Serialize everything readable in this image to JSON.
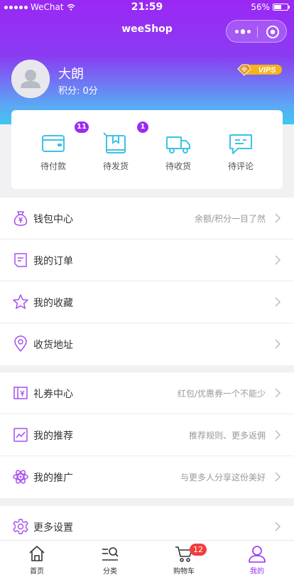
{
  "status_bar": {
    "carrier": "WeChat",
    "time": "21:59",
    "battery_text": "56%",
    "battery_level": 0.56
  },
  "nav": {
    "title": "weeShop"
  },
  "user": {
    "name": "大朗",
    "points": "积分: 0分",
    "vip_text": "VIPS"
  },
  "orders": [
    {
      "label": "待付款",
      "badge": "11",
      "icon": "wallet-icon"
    },
    {
      "label": "待发货",
      "badge": "1",
      "icon": "package-icon"
    },
    {
      "label": "待收货",
      "badge": "",
      "icon": "truck-icon"
    },
    {
      "label": "待评论",
      "badge": "",
      "icon": "comment-icon"
    }
  ],
  "menu_group_1": [
    {
      "title": "钱包中心",
      "sub": "余额/积分一目了然",
      "icon": "money-bag-icon"
    },
    {
      "title": "我的订单",
      "sub": "",
      "icon": "order-icon"
    },
    {
      "title": "我的收藏",
      "sub": "",
      "icon": "star-icon"
    },
    {
      "title": "收货地址",
      "sub": "",
      "icon": "location-icon"
    }
  ],
  "menu_group_2": [
    {
      "title": "礼券中心",
      "sub": "红包/优惠券一个不能少",
      "icon": "coupon-icon"
    },
    {
      "title": "我的推荐",
      "sub": "推荐规则、更多返佣",
      "icon": "chart-icon"
    },
    {
      "title": "我的推广",
      "sub": "与更多人分享这份美好",
      "icon": "atom-icon"
    }
  ],
  "menu_group_3": [
    {
      "title": "更多设置",
      "sub": "",
      "icon": "gear-icon"
    }
  ],
  "tabs": [
    {
      "label": "首页",
      "icon": "home-icon",
      "active": false
    },
    {
      "label": "分类",
      "icon": "category-icon",
      "active": false
    },
    {
      "label": "购物车",
      "icon": "cart-icon",
      "active": false,
      "badge": "12"
    },
    {
      "label": "我的",
      "icon": "user-icon",
      "active": true
    }
  ],
  "colors": {
    "accent": "#9a2bf2",
    "gradient_top": "#9b27f5",
    "gradient_bottom": "#40c7f0",
    "badge_red": "#f23d3d",
    "icon_cyan": "#3cc3e6"
  }
}
